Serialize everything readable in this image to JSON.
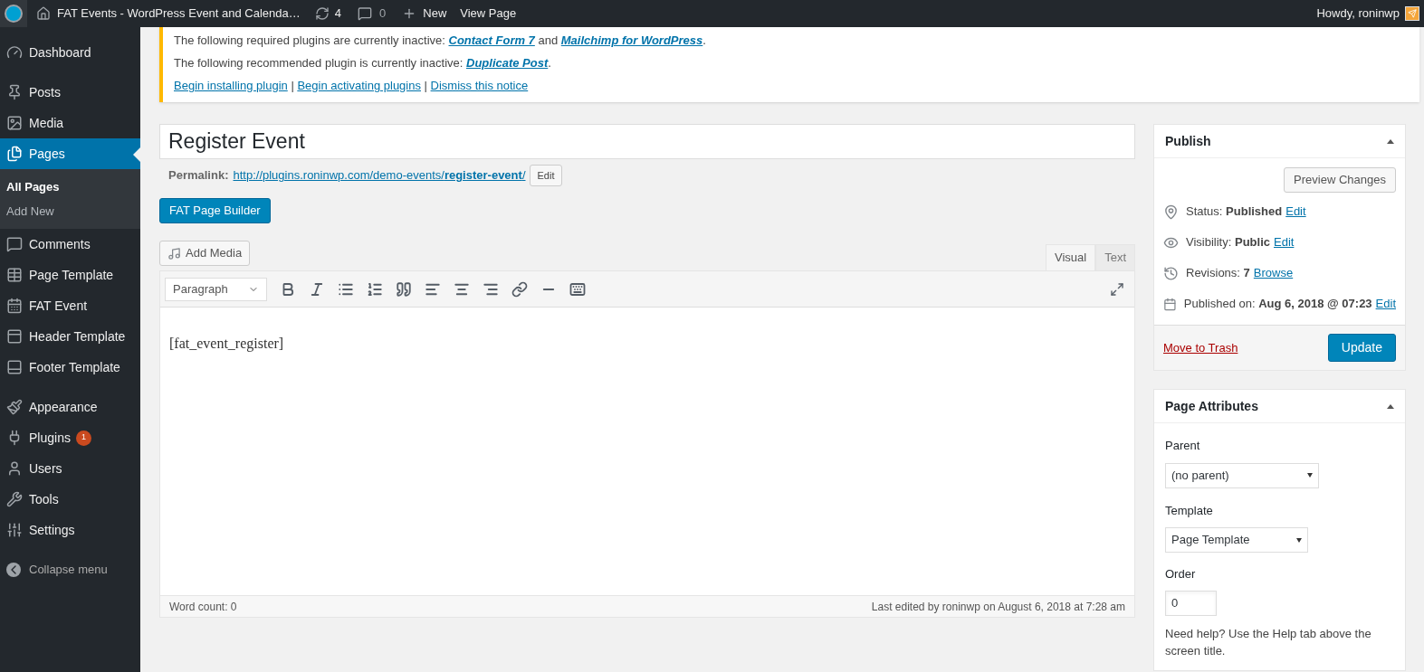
{
  "admin_bar": {
    "site_title": "FAT Events - WordPress Event and Calenda…",
    "updates": "4",
    "comments": "0",
    "new_label": "New",
    "view_label": "View Page",
    "greeting": "Howdy, roninwp"
  },
  "sidebar": {
    "groups": [
      [
        {
          "label": "Dashboard",
          "selected": false
        }
      ],
      [
        {
          "label": "Posts",
          "selected": false
        },
        {
          "label": "Media",
          "selected": false
        },
        {
          "label": "Pages",
          "selected": true,
          "children": [
            {
              "label": "All Pages",
              "selected": true
            },
            {
              "label": "Add New",
              "selected": false
            }
          ]
        },
        {
          "label": "Comments",
          "selected": false
        },
        {
          "label": "Page Template",
          "selected": false
        },
        {
          "label": "FAT Event",
          "selected": false
        },
        {
          "label": "Header Template",
          "selected": false
        },
        {
          "label": "Footer Template",
          "selected": false
        }
      ],
      [
        {
          "label": "Appearance",
          "selected": false
        },
        {
          "label": "Plugins",
          "selected": false,
          "badge": "1"
        },
        {
          "label": "Users",
          "selected": false
        },
        {
          "label": "Tools",
          "selected": false
        },
        {
          "label": "Settings",
          "selected": false
        }
      ]
    ],
    "collapse_label": "Collapse menu"
  },
  "notice": {
    "lines": [
      [
        {
          "kind": "text",
          "text": "The following required plugins are currently inactive: "
        },
        {
          "kind": "link",
          "text": "Contact Form 7"
        },
        {
          "kind": "text",
          "text": " and "
        },
        {
          "kind": "link",
          "text": "Mailchimp for WordPress"
        },
        {
          "kind": "text",
          "text": "."
        }
      ],
      [
        {
          "kind": "text",
          "text": "The following recommended plugin is currently inactive: "
        },
        {
          "kind": "link",
          "text": "Duplicate Post"
        },
        {
          "kind": "text",
          "text": "."
        }
      ],
      [
        {
          "kind": "action",
          "text": "Begin installing plugin"
        },
        {
          "kind": "text",
          "text": " | "
        },
        {
          "kind": "action",
          "text": "Begin activating plugins"
        },
        {
          "kind": "text",
          "text": " | "
        },
        {
          "kind": "action",
          "text": "Dismiss this notice"
        }
      ]
    ]
  },
  "editor": {
    "title": "Register Event",
    "permalink_label": "Permalink:",
    "permalink_url": "http://plugins.roninwp.com/demo-events/",
    "permalink_slug": "register-event",
    "permalink_end": "/",
    "permalink_edit": "Edit",
    "builder_button": "FAT Page Builder",
    "add_media": "Add Media",
    "tabs": [
      {
        "label": "Visual",
        "selected": true
      },
      {
        "label": "Text",
        "selected": false
      }
    ],
    "format": "Paragraph",
    "content": "[fat_event_register]",
    "word_count": "Word count: 0",
    "last_edited": "Last edited by roninwp on August 6, 2018 at 7:28 am"
  },
  "publish": {
    "title": "Publish",
    "preview": "Preview Changes",
    "rows": [
      {
        "label": "Status:",
        "value": "Published",
        "link": "Edit"
      },
      {
        "label": "Visibility:",
        "value": "Public",
        "link": "Edit"
      },
      {
        "label": "Revisions:",
        "value": "7",
        "link": "Browse"
      },
      {
        "label": "Published on:",
        "value": "Aug 6, 2018 @ 07:23",
        "link": "Edit"
      }
    ],
    "trash": "Move to Trash",
    "update": "Update"
  },
  "page_attributes": {
    "title": "Page Attributes",
    "parent_label": "Parent",
    "parent_value": "(no parent)",
    "template_label": "Template",
    "template_value": "Page Template",
    "order_label": "Order",
    "order_value": "0",
    "help": "Need help? Use the Help tab above the screen title."
  }
}
